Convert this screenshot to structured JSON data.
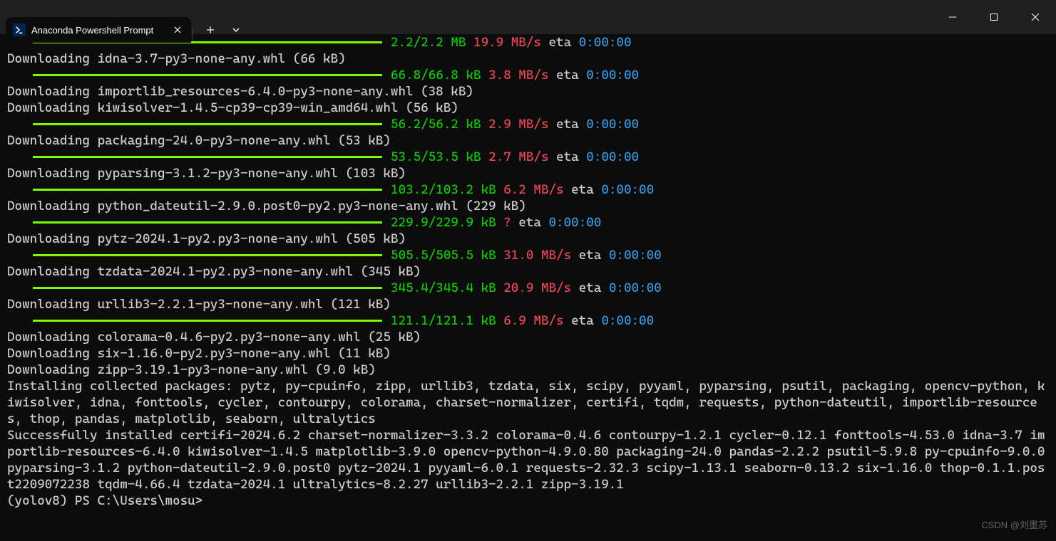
{
  "window": {
    "tab_title": "Anaconda Powershell Prompt"
  },
  "lines": [
    {
      "type": "bar",
      "size": "2.2/2.2 MB",
      "speed": "19.9 MB/s",
      "eta": "0:00:00"
    },
    {
      "type": "text",
      "text": "Downloading idna-3.7-py3-none-any.whl (66 kB)"
    },
    {
      "type": "bar",
      "size": "66.8/66.8 kB",
      "speed": "3.8 MB/s",
      "eta": "0:00:00"
    },
    {
      "type": "text",
      "text": "Downloading importlib_resources-6.4.0-py3-none-any.whl (38 kB)"
    },
    {
      "type": "text",
      "text": "Downloading kiwisolver-1.4.5-cp39-cp39-win_amd64.whl (56 kB)"
    },
    {
      "type": "bar",
      "size": "56.2/56.2 kB",
      "speed": "2.9 MB/s",
      "eta": "0:00:00"
    },
    {
      "type": "text",
      "text": "Downloading packaging-24.0-py3-none-any.whl (53 kB)"
    },
    {
      "type": "bar",
      "size": "53.5/53.5 kB",
      "speed": "2.7 MB/s",
      "eta": "0:00:00"
    },
    {
      "type": "text",
      "text": "Downloading pyparsing-3.1.2-py3-none-any.whl (103 kB)"
    },
    {
      "type": "bar",
      "size": "103.2/103.2 kB",
      "speed": "6.2 MB/s",
      "eta": "0:00:00"
    },
    {
      "type": "text",
      "text": "Downloading python_dateutil-2.9.0.post0-py2.py3-none-any.whl (229 kB)"
    },
    {
      "type": "bar",
      "size": "229.9/229.9 kB",
      "speed": "?",
      "eta": "0:00:00"
    },
    {
      "type": "text",
      "text": "Downloading pytz-2024.1-py2.py3-none-any.whl (505 kB)"
    },
    {
      "type": "bar",
      "size": "505.5/505.5 kB",
      "speed": "31.0 MB/s",
      "eta": "0:00:00"
    },
    {
      "type": "text",
      "text": "Downloading tzdata-2024.1-py2.py3-none-any.whl (345 kB)"
    },
    {
      "type": "bar",
      "size": "345.4/345.4 kB",
      "speed": "20.9 MB/s",
      "eta": "0:00:00"
    },
    {
      "type": "text",
      "text": "Downloading urllib3-2.2.1-py3-none-any.whl (121 kB)"
    },
    {
      "type": "bar",
      "size": "121.1/121.1 kB",
      "speed": "6.9 MB/s",
      "eta": "0:00:00"
    },
    {
      "type": "text",
      "text": "Downloading colorama-0.4.6-py2.py3-none-any.whl (25 kB)"
    },
    {
      "type": "text",
      "text": "Downloading six-1.16.0-py2.py3-none-any.whl (11 kB)"
    },
    {
      "type": "text",
      "text": "Downloading zipp-3.19.1-py3-none-any.whl (9.0 kB)"
    },
    {
      "type": "wrap",
      "text": "Installing collected packages: pytz, py-cpuinfo, zipp, urllib3, tzdata, six, scipy, pyyaml, pyparsing, psutil, packaging, opencv-python, kiwisolver, idna, fonttools, cycler, contourpy, colorama, charset-normalizer, certifi, tqdm, requests, python-dateutil, importlib-resources, thop, pandas, matplotlib, seaborn, ultralytics"
    },
    {
      "type": "wrap",
      "text": "Successfully installed certifi-2024.6.2 charset-normalizer-3.3.2 colorama-0.4.6 contourpy-1.2.1 cycler-0.12.1 fonttools-4.53.0 idna-3.7 importlib-resources-6.4.0 kiwisolver-1.4.5 matplotlib-3.9.0 opencv-python-4.9.0.80 packaging-24.0 pandas-2.2.2 psutil-5.9.8 py-cpuinfo-9.0.0 pyparsing-3.1.2 python-dateutil-2.9.0.post0 pytz-2024.1 pyyaml-6.0.1 requests-2.32.3 scipy-1.13.1 seaborn-0.13.2 six-1.16.0 thop-0.1.1.post2209072238 tqdm-4.66.4 tzdata-2024.1 ultralytics-8.2.27 urllib3-2.2.1 zipp-3.19.1"
    },
    {
      "type": "text",
      "text": "(yolov8) PS C:\\Users\\mosu>"
    }
  ],
  "watermark": "CSDN @刘墨苏"
}
